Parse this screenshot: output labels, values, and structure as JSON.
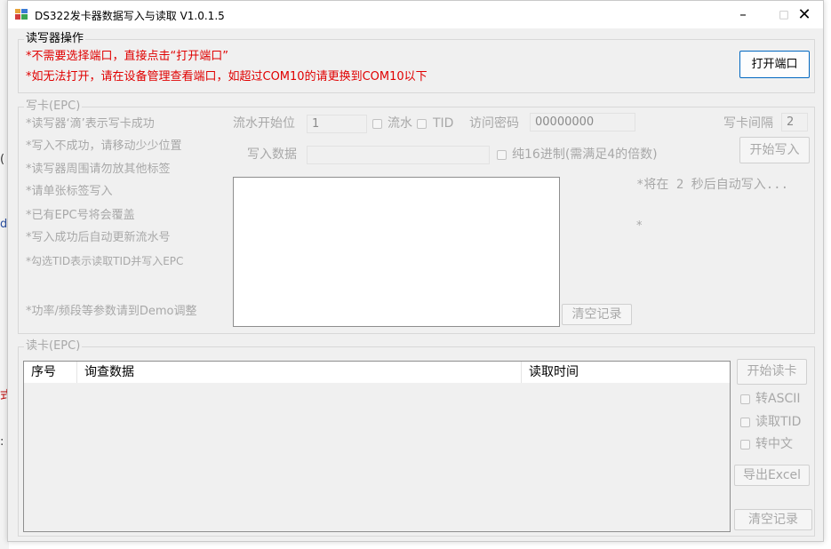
{
  "window": {
    "title": "DS322发卡器数据写入与读取 V1.0.1.5"
  },
  "rw_group": {
    "title": "读写器操作",
    "note1": "*不需要选择端口，直接点击“打开端口”",
    "note2": "*如无法打开，请在设备管理查看端口，如超过COM10的请更换到COM10以下",
    "open_port_label": "打开端口"
  },
  "write_group": {
    "title": "写卡(EPC)",
    "tips": [
      "*读写器‘滴’表示写卡成功",
      "*写入不成功，请移动少少位置",
      "*读写器周围请勿放其他标签",
      "*请单张标签写入",
      "*已有EPC号将会覆盖",
      "*写入成功后自动更新流水号",
      "*勾选TID表示读取TID并写入EPC"
    ],
    "tip_power": "*功率/频段等参数请到Demo调整",
    "serial_start_label": "流水开始位",
    "serial_start_value": "1",
    "serial_check_label": "流水",
    "tid_check_label": "TID",
    "password_label": "访问密码",
    "password_value": "00000000",
    "interval_label": "写卡间隔",
    "interval_value": "2",
    "write_data_label": "写入数据",
    "write_data_value": "",
    "hex_check_label": "纯16进制(需满足4的倍数)",
    "start_write_label": "开始写入",
    "auto_write_note": "*将在 2 秒后自动写入...",
    "status_star": "*",
    "clear_log_label": "清空记录"
  },
  "read_group": {
    "title": "读卡(EPC)",
    "columns": [
      "序号",
      "询查数据",
      "读取时间"
    ],
    "start_read_label": "开始读卡",
    "ascii_label": "转ASCII",
    "read_tid_label": "读取TID",
    "chinese_label": "转中文",
    "export_label": "导出Excel",
    "clear_log_label": "清空记录"
  },
  "colors": {
    "accent": "#0067c0",
    "warning_red": "#e00000",
    "disabled_text": "#a8a8a8",
    "window_bg": "#f0f0f0"
  },
  "icons": {
    "app": "app-grid-icon",
    "minimize": "minimize-icon",
    "maximize": "maximize-icon",
    "close": "close-icon"
  }
}
